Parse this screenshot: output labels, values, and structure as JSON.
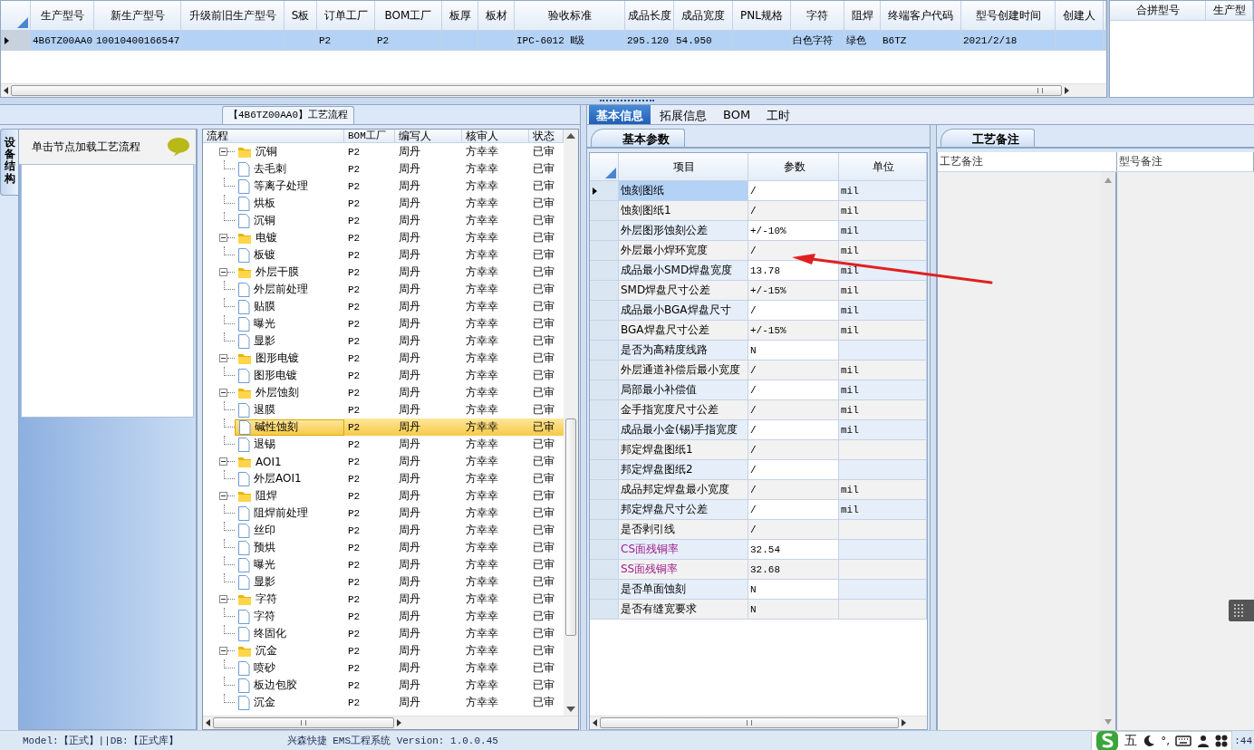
{
  "main_grid": {
    "columns": [
      "生产型号",
      "新生产型号",
      "升级前旧生产型号",
      "S板",
      "订单工厂",
      "BOM工厂",
      "板厚",
      "板材",
      "验收标准",
      "成品长度",
      "成品宽度",
      "PNL规格",
      "字符",
      "阻焊",
      "终端客户代码",
      "型号创建时间",
      "创建人"
    ],
    "rows": [
      {
        "selected": true,
        "cells": [
          "4B6TZ00AA0",
          "10010400166547",
          "",
          "",
          "P2",
          "P2",
          "",
          "",
          "IPC-6012 Ⅱ级",
          "295.120",
          "54.950",
          "",
          "白色字符",
          "绿色",
          "B6TZ",
          "2021/2/18",
          ""
        ]
      }
    ]
  },
  "merge_grid": {
    "columns": [
      "合拼型号",
      "生产型"
    ]
  },
  "side_tab": {
    "label": "设备结构"
  },
  "hint": {
    "text": "单击节点加载工艺流程"
  },
  "process_panel": {
    "title": "【4B6TZ00AA0】工艺流程"
  },
  "process_tree": {
    "columns": [
      "流程",
      "BOM工厂",
      "编写人",
      "核审人",
      "状态"
    ],
    "nodes": [
      {
        "label": "沉铜",
        "bom": "P2",
        "writer": "周丹",
        "reviewer": "方幸幸",
        "status": "已审",
        "expanded": true,
        "selected": false,
        "children": [
          {
            "label": "去毛刺",
            "bom": "P2",
            "writer": "周丹",
            "reviewer": "方幸幸",
            "status": "已审",
            "selected": false
          },
          {
            "label": "等离子处理",
            "bom": "P2",
            "writer": "周丹",
            "reviewer": "方幸幸",
            "status": "已审",
            "selected": false
          },
          {
            "label": "烘板",
            "bom": "P2",
            "writer": "周丹",
            "reviewer": "方幸幸",
            "status": "已审",
            "selected": false
          },
          {
            "label": "沉铜",
            "bom": "P2",
            "writer": "周丹",
            "reviewer": "方幸幸",
            "status": "已审",
            "selected": false
          }
        ]
      },
      {
        "label": "电镀",
        "bom": "P2",
        "writer": "周丹",
        "reviewer": "方幸幸",
        "status": "已审",
        "expanded": true,
        "selected": false,
        "children": [
          {
            "label": "板镀",
            "bom": "P2",
            "writer": "周丹",
            "reviewer": "方幸幸",
            "status": "已审",
            "selected": false
          }
        ]
      },
      {
        "label": "外层干膜",
        "bom": "P2",
        "writer": "周丹",
        "reviewer": "方幸幸",
        "status": "已审",
        "expanded": true,
        "selected": false,
        "children": [
          {
            "label": "外层前处理",
            "bom": "P2",
            "writer": "周丹",
            "reviewer": "方幸幸",
            "status": "已审",
            "selected": false
          },
          {
            "label": "贴膜",
            "bom": "P2",
            "writer": "周丹",
            "reviewer": "方幸幸",
            "status": "已审",
            "selected": false
          },
          {
            "label": "曝光",
            "bom": "P2",
            "writer": "周丹",
            "reviewer": "方幸幸",
            "status": "已审",
            "selected": false
          },
          {
            "label": "显影",
            "bom": "P2",
            "writer": "周丹",
            "reviewer": "方幸幸",
            "status": "已审",
            "selected": false
          }
        ]
      },
      {
        "label": "图形电镀",
        "bom": "P2",
        "writer": "周丹",
        "reviewer": "方幸幸",
        "status": "已审",
        "expanded": true,
        "selected": false,
        "children": [
          {
            "label": "图形电镀",
            "bom": "P2",
            "writer": "周丹",
            "reviewer": "方幸幸",
            "status": "已审",
            "selected": false
          }
        ]
      },
      {
        "label": "外层蚀刻",
        "bom": "P2",
        "writer": "周丹",
        "reviewer": "方幸幸",
        "status": "已审",
        "expanded": true,
        "selected": false,
        "children": [
          {
            "label": "退膜",
            "bom": "P2",
            "writer": "周丹",
            "reviewer": "方幸幸",
            "status": "已审",
            "selected": false
          },
          {
            "label": "碱性蚀刻",
            "bom": "P2",
            "writer": "周丹",
            "reviewer": "方幸幸",
            "status": "已审",
            "selected": true
          },
          {
            "label": "退锡",
            "bom": "P2",
            "writer": "周丹",
            "reviewer": "方幸幸",
            "status": "已审",
            "selected": false
          }
        ]
      },
      {
        "label": "AOI1",
        "bom": "P2",
        "writer": "周丹",
        "reviewer": "方幸幸",
        "status": "已审",
        "expanded": true,
        "selected": false,
        "children": [
          {
            "label": "外层AOI1",
            "bom": "P2",
            "writer": "周丹",
            "reviewer": "方幸幸",
            "status": "已审",
            "selected": false
          }
        ]
      },
      {
        "label": "阻焊",
        "bom": "P2",
        "writer": "周丹",
        "reviewer": "方幸幸",
        "status": "已审",
        "expanded": true,
        "selected": false,
        "children": [
          {
            "label": "阻焊前处理",
            "bom": "P2",
            "writer": "周丹",
            "reviewer": "方幸幸",
            "status": "已审",
            "selected": false
          },
          {
            "label": "丝印",
            "bom": "P2",
            "writer": "周丹",
            "reviewer": "方幸幸",
            "status": "已审",
            "selected": false
          },
          {
            "label": "预烘",
            "bom": "P2",
            "writer": "周丹",
            "reviewer": "方幸幸",
            "status": "已审",
            "selected": false
          },
          {
            "label": "曝光",
            "bom": "P2",
            "writer": "周丹",
            "reviewer": "方幸幸",
            "status": "已审",
            "selected": false
          },
          {
            "label": "显影",
            "bom": "P2",
            "writer": "周丹",
            "reviewer": "方幸幸",
            "status": "已审",
            "selected": false
          }
        ]
      },
      {
        "label": "字符",
        "bom": "P2",
        "writer": "周丹",
        "reviewer": "方幸幸",
        "status": "已审",
        "expanded": true,
        "selected": false,
        "children": [
          {
            "label": "字符",
            "bom": "P2",
            "writer": "周丹",
            "reviewer": "方幸幸",
            "status": "已审",
            "selected": false
          },
          {
            "label": "终固化",
            "bom": "P2",
            "writer": "周丹",
            "reviewer": "方幸幸",
            "status": "已审",
            "selected": false
          }
        ]
      },
      {
        "label": "沉金",
        "bom": "P2",
        "writer": "周丹",
        "reviewer": "方幸幸",
        "status": "已审",
        "expanded": true,
        "selected": false,
        "children": [
          {
            "label": "喷砂",
            "bom": "P2",
            "writer": "周丹",
            "reviewer": "方幸幸",
            "status": "已审",
            "selected": false
          },
          {
            "label": "板边包胶",
            "bom": "P2",
            "writer": "周丹",
            "reviewer": "方幸幸",
            "status": "已审",
            "selected": false
          },
          {
            "label": "沉金",
            "bom": "P2",
            "writer": "周丹",
            "reviewer": "方幸幸",
            "status": "已审",
            "selected": false
          }
        ]
      }
    ]
  },
  "detail_tabs": [
    {
      "label": "基本信息",
      "selected": true
    },
    {
      "label": "拓展信息",
      "selected": false
    },
    {
      "label": "BOM",
      "selected": false
    },
    {
      "label": "工时",
      "selected": false
    }
  ],
  "params_panel": {
    "tab": "基本参数",
    "columns": [
      "项目",
      "参数",
      "单位"
    ],
    "rows": [
      {
        "item": "蚀刻图纸",
        "value": "/",
        "unit": "mil",
        "selected": true
      },
      {
        "item": "蚀刻图纸1",
        "value": "/",
        "unit": "mil",
        "selected": false
      },
      {
        "item": "外层图形蚀刻公差",
        "value": "+/-10%",
        "unit": "mil",
        "selected": false
      },
      {
        "item": "外层最小焊环宽度",
        "value": "/",
        "unit": "mil",
        "selected": false
      },
      {
        "item": "成品最小SMD焊盘宽度",
        "value": "13.78",
        "unit": "mil",
        "selected": false
      },
      {
        "item": "SMD焊盘尺寸公差",
        "value": "+/-15%",
        "unit": "mil",
        "selected": false
      },
      {
        "item": "成品最小BGA焊盘尺寸",
        "value": "/",
        "unit": "mil",
        "selected": false
      },
      {
        "item": "BGA焊盘尺寸公差",
        "value": "+/-15%",
        "unit": "mil",
        "selected": false
      },
      {
        "item": "是否为高精度线路",
        "value": "N",
        "selected": false
      },
      {
        "item": "外层通道补偿后最小宽度",
        "value": "/",
        "unit": "mil",
        "selected": false
      },
      {
        "item": "局部最小补偿值",
        "value": "/",
        "unit": "mil",
        "selected": false
      },
      {
        "item": "金手指宽度尺寸公差",
        "value": "/",
        "unit": "mil",
        "selected": false
      },
      {
        "item": "成品最小金(锡)手指宽度",
        "value": "/",
        "unit": "mil",
        "selected": false
      },
      {
        "item": "邦定焊盘图纸1",
        "value": "/",
        "selected": false
      },
      {
        "item": "邦定焊盘图纸2",
        "value": "/",
        "selected": false
      },
      {
        "item": "成品邦定焊盘最小宽度",
        "value": "/",
        "unit": "mil",
        "selected": false
      },
      {
        "item": "邦定焊盘尺寸公差",
        "value": "/",
        "unit": "mil",
        "selected": false
      },
      {
        "item": "是否剥引线",
        "value": "/",
        "selected": false
      },
      {
        "item": "CS面残铜率",
        "value": "32.54",
        "color": "#a0208c",
        "selected": false
      },
      {
        "item": "SS面残铜率",
        "value": "32.68",
        "color": "#a0208c",
        "selected": false
      },
      {
        "item": "是否单面蚀刻",
        "value": "N",
        "selected": false
      },
      {
        "item": "是否有缝宽要求",
        "value": "N",
        "selected": false
      }
    ]
  },
  "notes_panel": {
    "tab": "工艺备注",
    "columns": [
      "工艺备注",
      "型号备注"
    ]
  },
  "status_bar": {
    "left": "Model:【正式】||DB:【正式库】",
    "right": "兴森快捷 EMS工程系统 Version: 1.0.0.45",
    "clock": ":44"
  },
  "ime_toolbar": {
    "mode": "五",
    "punctuation": "°,"
  }
}
